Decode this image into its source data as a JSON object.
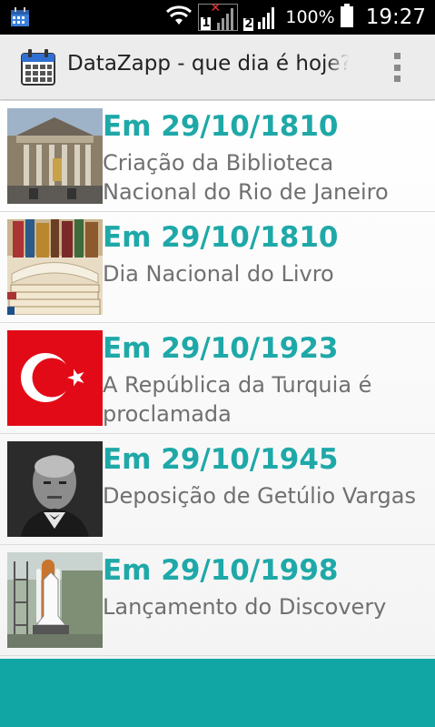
{
  "status_bar": {
    "sim1_label": "1",
    "sim2_label": "2",
    "battery_percent": "100%",
    "time": "19:27"
  },
  "action_bar": {
    "title": "DataZapp - que dia é hoje?"
  },
  "events": [
    {
      "date": "Em 29/10/1810",
      "description": "Criação da Biblioteca Nacional do Rio de Janeiro"
    },
    {
      "date": "Em 29/10/1810",
      "description": "Dia Nacional do Livro"
    },
    {
      "date": "Em 29/10/1923",
      "description": "A República da Turquia é proclamada"
    },
    {
      "date": "Em 29/10/1945",
      "description": "Deposição de Getúlio Vargas"
    },
    {
      "date": "Em 29/10/1998",
      "description": "Lançamento do Discovery"
    }
  ],
  "colors": {
    "accent": "#1fa8a8",
    "footer": "#11a6a4",
    "turkey_red": "#e30a17"
  }
}
